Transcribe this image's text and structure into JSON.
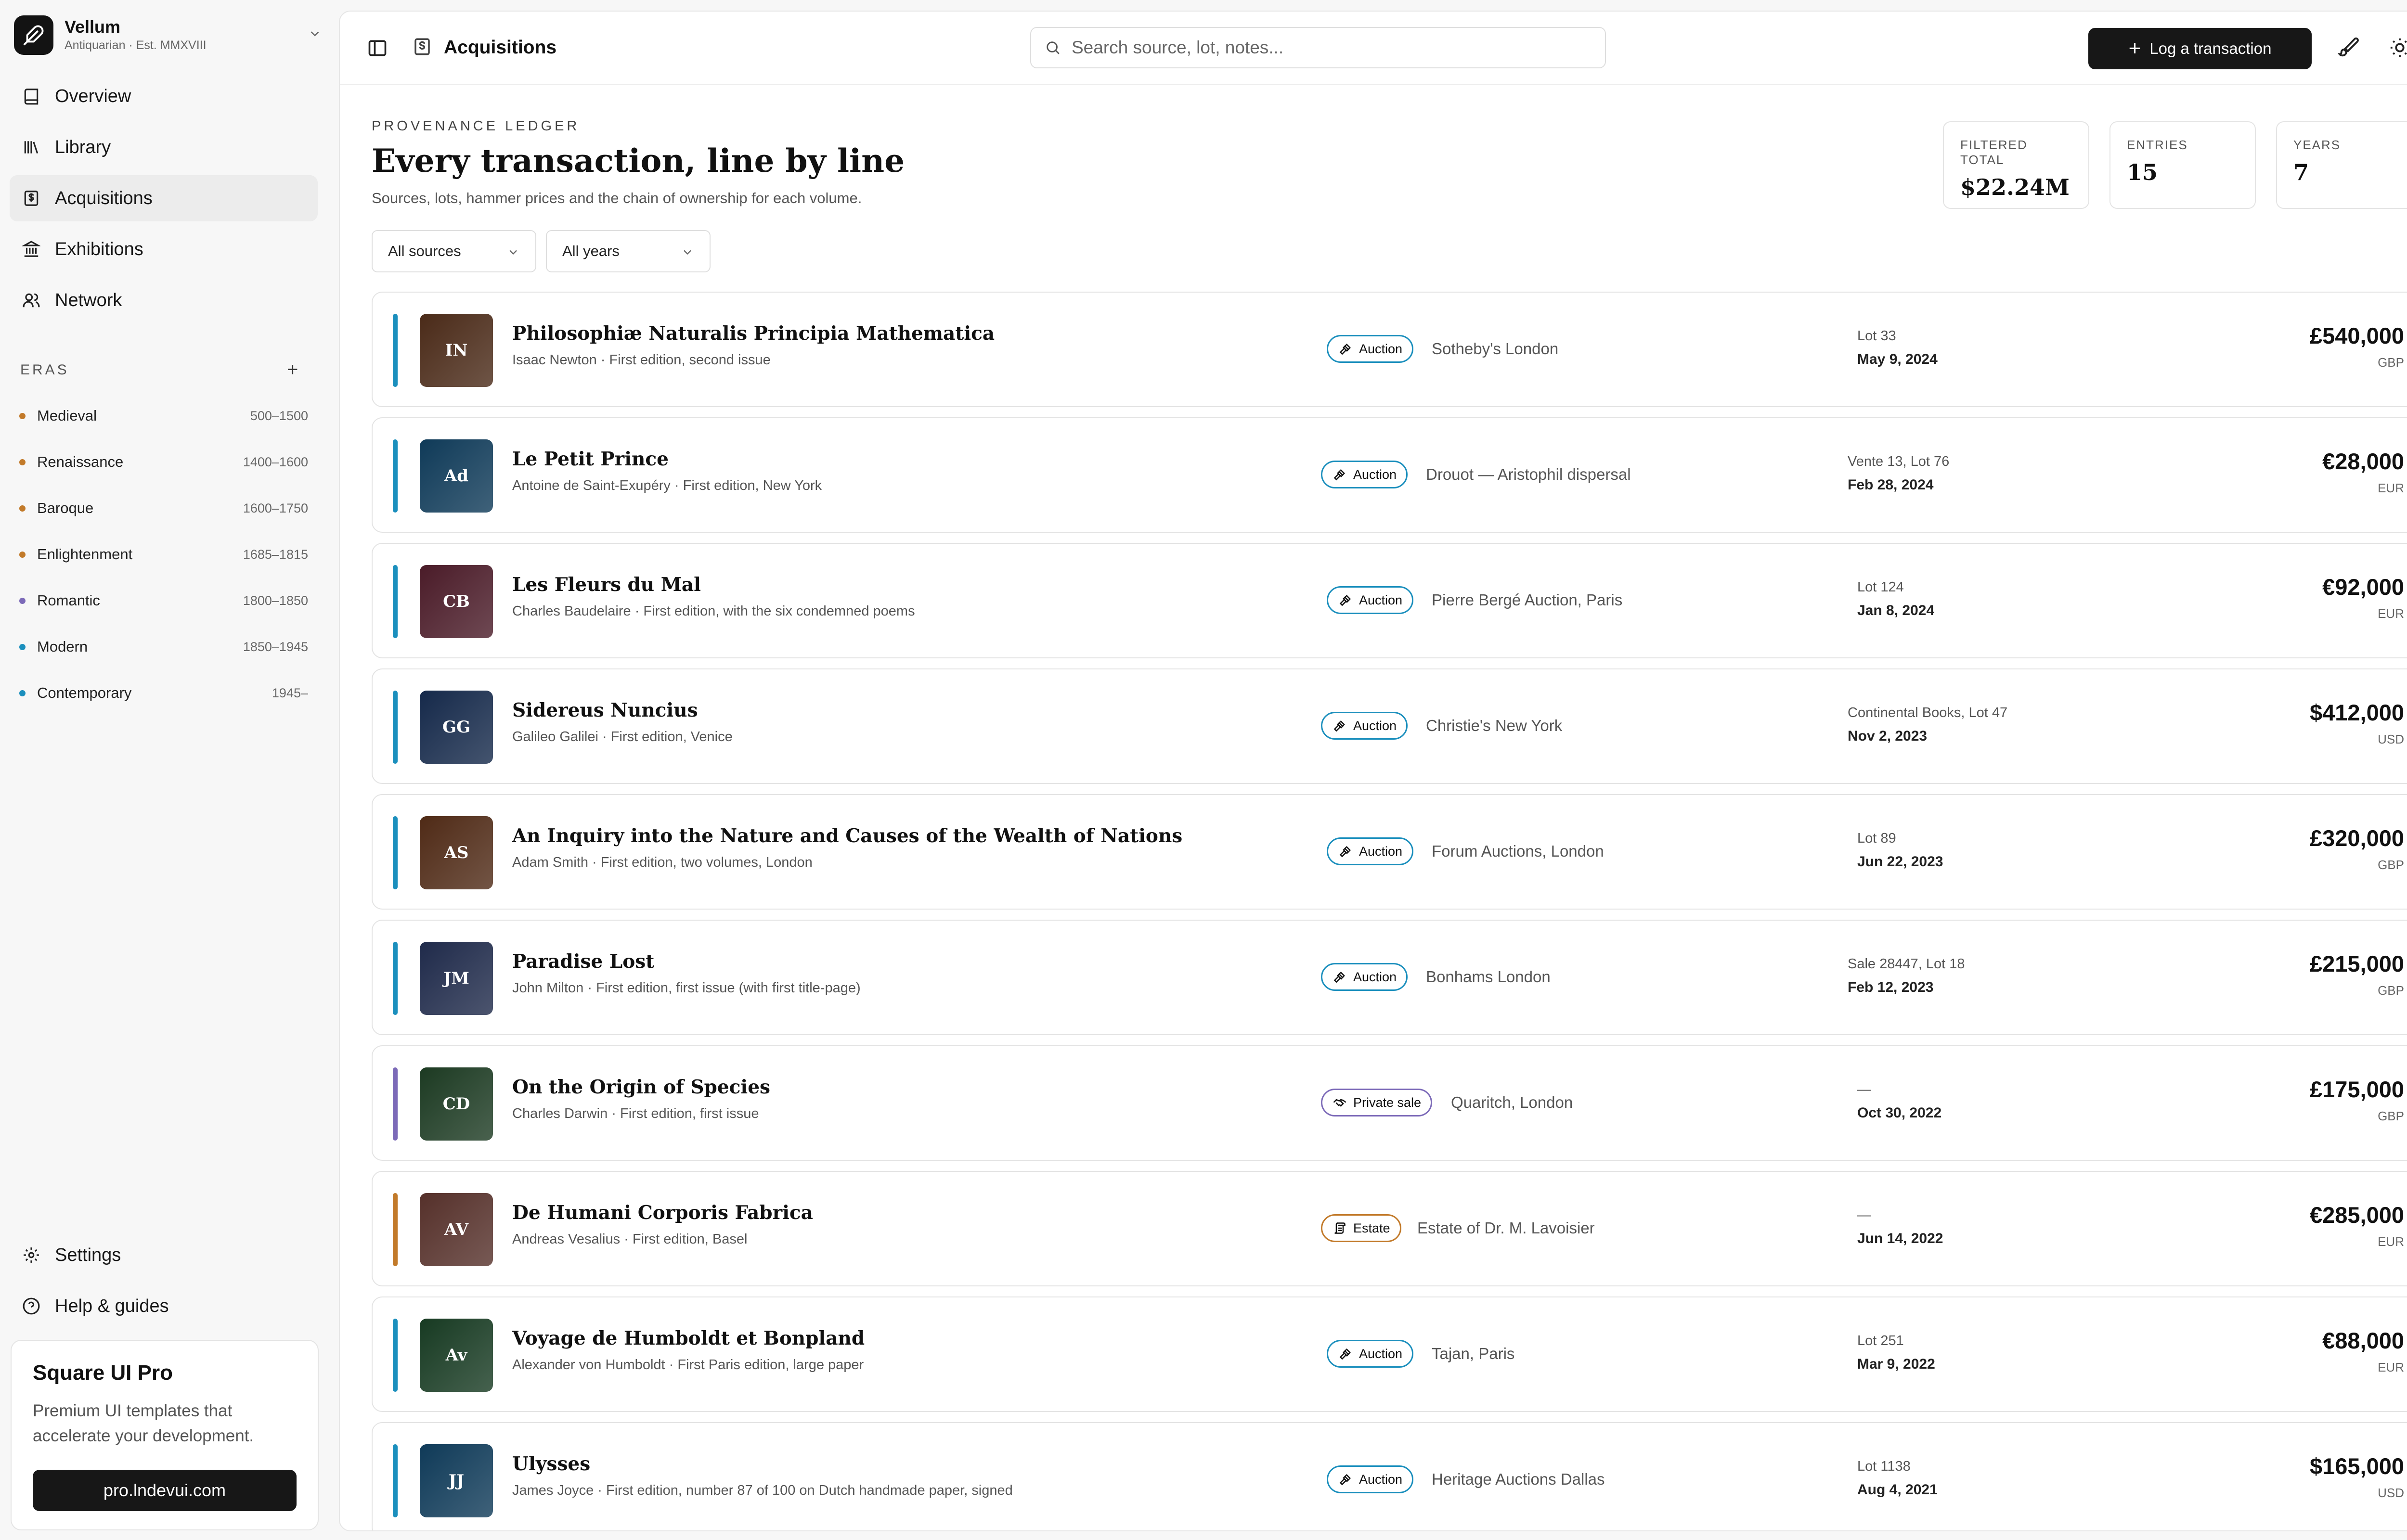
{
  "brand": {
    "name": "Vellum",
    "tagline": "Antiquarian · Est. MMXVIII"
  },
  "nav": [
    {
      "label": "Overview",
      "icon": "book-icon"
    },
    {
      "label": "Library",
      "icon": "library-icon"
    },
    {
      "label": "Acquisitions",
      "icon": "receipt-icon",
      "active": true
    },
    {
      "label": "Exhibitions",
      "icon": "landmark-icon"
    },
    {
      "label": "Network",
      "icon": "users-icon"
    }
  ],
  "eras": {
    "title": "ERAS",
    "add_label": "+",
    "items": [
      {
        "name": "Medieval",
        "range": "500–1500",
        "color": "#c27a2a"
      },
      {
        "name": "Renaissance",
        "range": "1400–1600",
        "color": "#c27a2a"
      },
      {
        "name": "Baroque",
        "range": "1600–1750",
        "color": "#c27a2a"
      },
      {
        "name": "Enlightenment",
        "range": "1685–1815",
        "color": "#c27a2a"
      },
      {
        "name": "Romantic",
        "range": "1800–1850",
        "color": "#7c6ab8"
      },
      {
        "name": "Modern",
        "range": "1850–1945",
        "color": "#1b8fbd"
      },
      {
        "name": "Contemporary",
        "range": "1945–",
        "color": "#1b8fbd"
      }
    ]
  },
  "footer_nav": [
    {
      "label": "Settings",
      "icon": "gear-icon"
    },
    {
      "label": "Help & guides",
      "icon": "help-circle-icon"
    }
  ],
  "promo": {
    "title": "Square UI Pro",
    "text": "Premium UI templates that accelerate your development.",
    "button": "pro.lndevui.com"
  },
  "topbar": {
    "title": "Acquisitions",
    "search_placeholder": "Search source, lot, notes...",
    "log_button": "Log a transaction"
  },
  "header": {
    "eyebrow": "PROVENANCE LEDGER",
    "title": "Every transaction, line by line",
    "subtitle": "Sources, lots, hammer prices and the chain of ownership for each volume."
  },
  "stats": [
    {
      "label": "FILTERED TOTAL",
      "value": "$22.24M"
    },
    {
      "label": "ENTRIES",
      "value": "15"
    },
    {
      "label": "YEARS",
      "value": "7"
    }
  ],
  "filters": {
    "source": "All sources",
    "year": "All years"
  },
  "colors": {
    "auction": "#1b8fbd",
    "private": "#7c6ab8",
    "estate": "#c27a2a"
  },
  "transactions": [
    {
      "initials": "IN",
      "title": "Philosophiæ Naturalis Principia Mathematica",
      "subtitle": "Isaac Newton · First edition, second issue",
      "type": "Auction",
      "source": "Sotheby's London",
      "lot": "Lot 33",
      "date": "May 9, 2024",
      "price": "£540,000",
      "currency": "GBP",
      "thumb": "#4a2a18",
      "accent": "#1b8fbd"
    },
    {
      "initials": "Ad",
      "title": "Le Petit Prince",
      "subtitle": "Antoine de Saint-Exupéry · First edition, New York",
      "type": "Auction",
      "source": "Drouot — Aristophil dispersal",
      "lot": "Vente 13, Lot 76",
      "date": "Feb 28, 2024",
      "price": "€28,000",
      "currency": "EUR",
      "thumb": "#0f3a58",
      "accent": "#1b8fbd"
    },
    {
      "initials": "CB",
      "title": "Les Fleurs du Mal",
      "subtitle": "Charles Baudelaire · First edition, with the six condemned poems",
      "type": "Auction",
      "source": "Pierre Bergé Auction, Paris",
      "lot": "Lot 124",
      "date": "Jan 8, 2024",
      "price": "€92,000",
      "currency": "EUR",
      "thumb": "#4a1b28",
      "accent": "#1b8fbd"
    },
    {
      "initials": "GG",
      "title": "Sidereus Nuncius",
      "subtitle": "Galileo Galilei · First edition, Venice",
      "type": "Auction",
      "source": "Christie's New York",
      "lot": "Continental Books, Lot 47",
      "date": "Nov 2, 2023",
      "price": "$412,000",
      "currency": "USD",
      "thumb": "#15294a",
      "accent": "#1b8fbd"
    },
    {
      "initials": "AS",
      "title": "An Inquiry into the Nature and Causes of the Wealth of Nations",
      "subtitle": "Adam Smith · First edition, two volumes, London",
      "type": "Auction",
      "source": "Forum Auctions, London",
      "lot": "Lot 89",
      "date": "Jun 22, 2023",
      "price": "£320,000",
      "currency": "GBP",
      "thumb": "#4f2a16",
      "accent": "#1b8fbd"
    },
    {
      "initials": "JM",
      "title": "Paradise Lost",
      "subtitle": "John Milton · First edition, first issue (with first title-page)",
      "type": "Auction",
      "source": "Bonhams London",
      "lot": "Sale 28447, Lot 18",
      "date": "Feb 12, 2023",
      "price": "£215,000",
      "currency": "GBP",
      "thumb": "#1f2a4a",
      "accent": "#1b8fbd"
    },
    {
      "initials": "CD",
      "title": "On the Origin of Species",
      "subtitle": "Charles Darwin · First edition, first issue",
      "type": "Private sale",
      "source": "Quaritch, London",
      "lot": "—",
      "date": "Oct 30, 2022",
      "price": "£175,000",
      "currency": "GBP",
      "thumb": "#1c3a22",
      "accent": "#7c6ab8"
    },
    {
      "initials": "AV",
      "title": "De Humani Corporis Fabrica",
      "subtitle": "Andreas Vesalius · First edition, Basel",
      "type": "Estate",
      "source": "Estate of Dr. M. Lavoisier",
      "lot": "—",
      "date": "Jun 14, 2022",
      "price": "€285,000",
      "currency": "EUR",
      "thumb": "#55302a",
      "accent": "#c27a2a"
    },
    {
      "initials": "Av",
      "title": "Voyage de Humboldt et Bonpland",
      "subtitle": "Alexander von Humboldt · First Paris edition, large paper",
      "type": "Auction",
      "source": "Tajan, Paris",
      "lot": "Lot 251",
      "date": "Mar 9, 2022",
      "price": "€88,000",
      "currency": "EUR",
      "thumb": "#173a22",
      "accent": "#1b8fbd"
    },
    {
      "initials": "JJ",
      "title": "Ulysses",
      "subtitle": "James Joyce · First edition, number 87 of 100 on Dutch handmade paper, signed",
      "type": "Auction",
      "source": "Heritage Auctions Dallas",
      "lot": "Lot 1138",
      "date": "Aug 4, 2021",
      "price": "$165,000",
      "currency": "USD",
      "thumb": "#0f3a58",
      "accent": "#1b8fbd"
    }
  ]
}
